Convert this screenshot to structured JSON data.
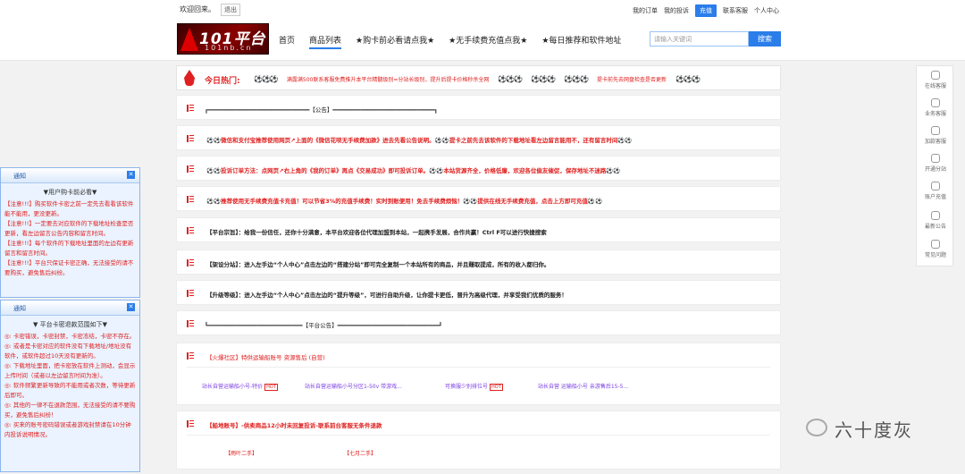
{
  "topbar": {
    "welcome": "欢迎回来。",
    "logout": "退出",
    "my_orders": "我的订单",
    "my_complaints": "我的投诉",
    "recharge": "充值",
    "contact_support": "联系客服",
    "user_center": "个人中心"
  },
  "header": {
    "logo_big": "101平台",
    "logo_small": "101nb.cn",
    "nav": [
      "首页",
      "商品列表",
      "★购卡前必看请点我★",
      "★无手续费充值点我★",
      "★每日推荐和软件地址"
    ],
    "search_placeholder": "请输入关键词",
    "search_button": "搜索"
  },
  "hot": {
    "label": "今日热门:",
    "ball": "⚽⚽⚽",
    "item1": "满露满500联系客服免费推升本平台精髓级别=分站长级别，提升后提卡价格秒杀全网",
    "item2": "提卡前先去网盘检查是否更新"
  },
  "rows": {
    "announce_top": "┏━━━━━━━━━━━━━━━━━━━━━━━━━━━━━【公告】━━━━━━━━━━━━━━━━━━━━━━━━━━━━━┓",
    "r1": "⚽⚽微信和支付宝推荐使用网页↗上面的《微信花呗无手续费加款》进去先看公告说明。⚽⚽提卡之前先去该软件的下载地址看左边留言能用不，还有留言时间⚽⚽",
    "r2": "⚽⚽投诉订单方法：点网页↗右上角的《我的订单》再点《交易成功》即可投诉订单。⚽⚽本站货源齐全，价格低廉，欢迎各位偷友催促，保存地址不迷路⚽⚽",
    "r3": "⚽⚽推荐使用无手续费充值卡充值！可以节省3%的充值手续费！实时到账便用！免去手续费烦恼！⚽⚽提供在线无手续费充值，点击上方即可充值⚽⚽",
    "r4": "【平台宗旨】：给我一份信任，还你十分满意，本平台欢迎各位代理加盟到本站，一起携手发展，合作共赢！Ctrl F可以进行快捷搜索",
    "r5": "【架设分站】：进入左手边“个人中心”点击左边的“搭建分站”即可完全复制一个本站所有的商品，并且赚取提成，所有的收入都归你。",
    "r6": "【升级等级】：进入左手边“个人中心”点击左边的“提升等级”，可进行自助升级，让你提卡更低，晋升为高级代理，并享受我们优质的服务！",
    "announce_platform": "┗━━━━━━━━━━━━━━━━━━━━━━━━━━━【平台公告】━━━━━━━━━━━━━━━━━━━━━━━━━━━━━┛"
  },
  "panel1": {
    "title": "【火爆社区】特供运输船账号 资源售后 (自营)",
    "links": [
      "站长自营运输船小号-特价",
      "站长自营运输船小号分区1-50v 带游戏...",
      "可换服少别排位号",
      "站长自营 运输船小号 亲游售后15-5..."
    ],
    "tag": "HOT"
  },
  "panel2": {
    "title": "【船地账号】-供卖商品12小时未回复投诉-联系前台客服无条件退款",
    "links": [
      "【雨叶二手】",
      "【七月二手】"
    ]
  },
  "notice1": {
    "head": "通知",
    "sub": "▼用户购卡前必看▼",
    "p1": "【注意!!!】购买软件卡密之前一定先去看看该软件能不能用，更没更新。",
    "p2": "【注意!!!】一定要去对应软件的下载地址检查是否更新，看左边留言公告内容和留言时间。",
    "p3": "【注意!!!】每个软件的下载地址里面的左边有更新留言和留言时间。",
    "p4": "【注意!!!】平台只保证卡密正确，无法接受的请不要购买，避免售后纠纷。"
  },
  "notice2": {
    "head": "通知",
    "sub": "▼ 平台卡密退款范围如下▼",
    "p1": "◎: 卡密错误，卡密封禁，卡密冻结，卡密不存在。",
    "p2": "◎: 或者是卡密对应的软件没有下载地址/地址没有软件，或软件超过10天没有更新的。",
    "p3": "◎: 下载地址里面，把卡密放在软件上测动，会显示上传时间（或者以左边留言时间为准）。",
    "p4": "◎: 软件频繁更新导致的不能用或者次数，等待更新后即可。",
    "p5": "◎: 其他的一律不在退款范围，无法接受的请不要购买，避免售后纠纷！",
    "p6": "◎: 买来的账号密码错误或者游戏封禁请在10分钟内投诉说明情况。"
  },
  "sidebar": [
    "在线客服",
    "业务客服",
    "加款客服",
    "开通分站",
    "账户充值",
    "最新公告",
    "常见问题"
  ],
  "watermark": "六十度灰",
  "colors": {
    "accent": "#2b7de9",
    "red": "#e02020"
  }
}
